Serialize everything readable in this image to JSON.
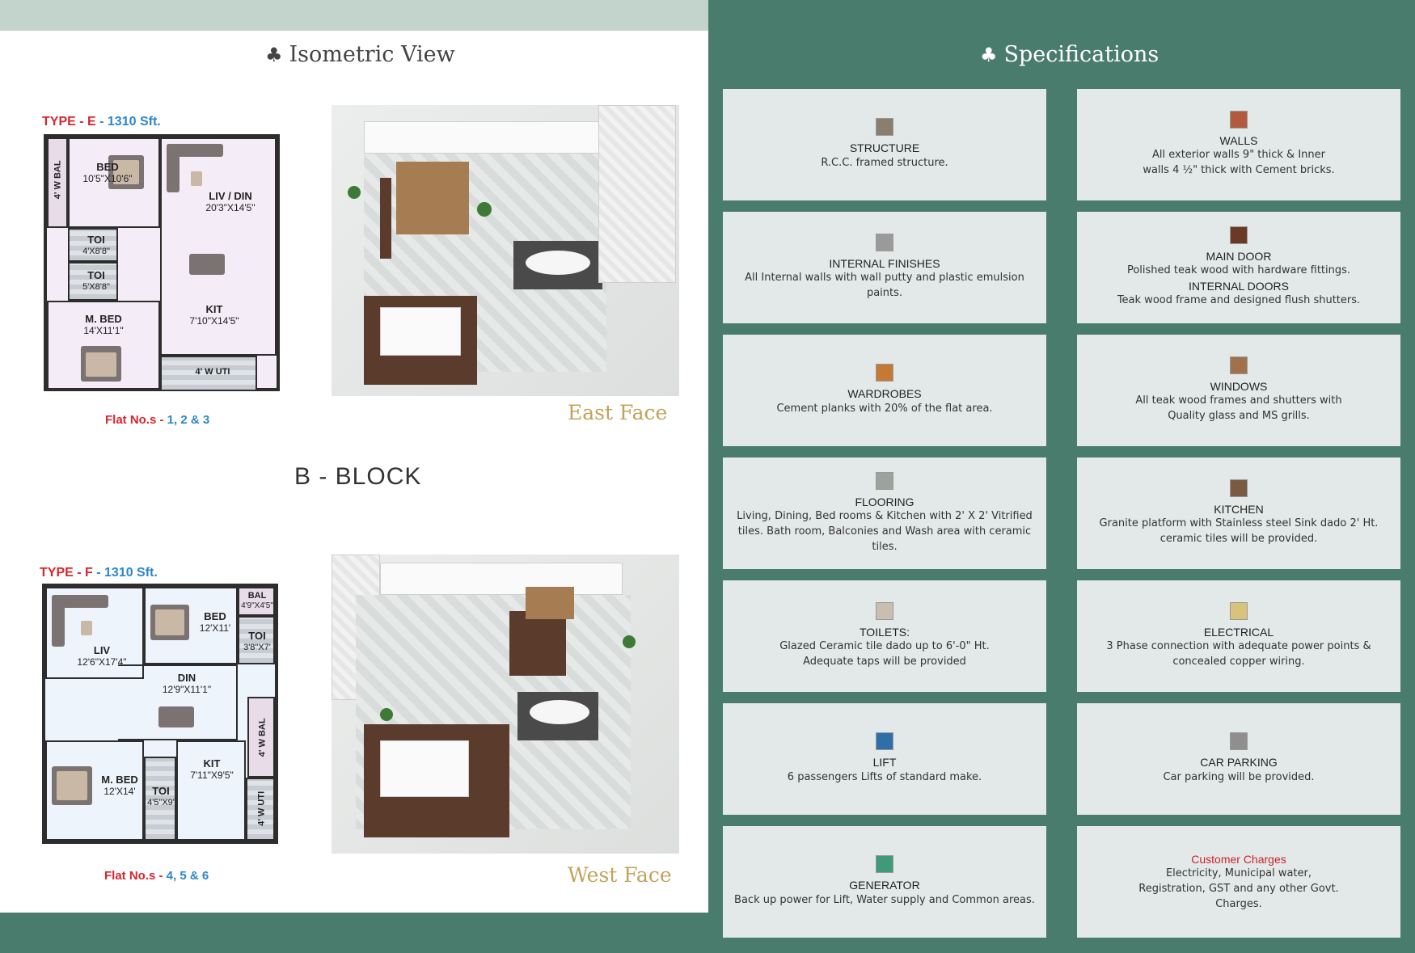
{
  "left": {
    "isometric_title": "Isometric View",
    "block_title": "B - BLOCK",
    "type_e": {
      "prefix": "TYPE - ",
      "letter": "E",
      "area": " - 1310 Sft."
    },
    "type_f": {
      "prefix": "TYPE - ",
      "letter": "F",
      "area": " - 1310 Sft."
    },
    "flat_e": {
      "label": "Flat No.s  - ",
      "numbers": " 1, 2 & 3"
    },
    "flat_f": {
      "label": "Flat No.s  - ",
      "numbers": " 4, 5 & 6"
    },
    "east_face": "East Face",
    "west_face": "West Face",
    "plan_e_rooms": {
      "bal": "4' W BAL",
      "bed_name": "BED",
      "bed_dim": "10'5\"X10'6\"",
      "liv_name": "LIV / DIN",
      "liv_dim": "20'3\"X14'5\"",
      "toi1_name": "TOI",
      "toi1_dim": "4'X8'8\"",
      "toi2_name": "TOI",
      "toi2_dim": "5'X8'8\"",
      "mbed_name": "M. BED",
      "mbed_dim": "14'X11'1\"",
      "kit_name": "KIT",
      "kit_dim": "7'10\"X14'5\"",
      "uti": "4' W UTI"
    },
    "plan_f_rooms": {
      "liv_name": "LIV",
      "liv_dim": "12'6\"X17'4\"",
      "bed_name": "BED",
      "bed_dim": "12'X11'",
      "bal_name": "BAL",
      "bal_dim": "4'9\"X4'5\"",
      "toi1_name": "TOI",
      "toi1_dim": "3'8\"X7'",
      "din_name": "DIN",
      "din_dim": "12'9\"X11'1\"",
      "bal2": "4' W BAL",
      "mbed_name": "M. BED",
      "mbed_dim": "12'X14'",
      "toi2_name": "TOI",
      "toi2_dim": "4'5\"X9'",
      "kit_name": "KIT",
      "kit_dim": "7'11\"X9'5\"",
      "uti": "4' W UTI"
    }
  },
  "right": {
    "specifications_title": "Specifications",
    "specs": [
      {
        "title": "STRUCTURE",
        "desc": "R.C.C. framed structure."
      },
      {
        "title": "WALLS",
        "desc": "All exterior walls 9\" thick & Inner walls 4 ½\" thick with Cement bricks."
      },
      {
        "title": "INTERNAL FINISHES",
        "desc": "All Internal walls with wall putty and plastic emulsion paints."
      },
      {
        "title": "MAIN DOOR",
        "desc": "Polished teak wood with hardware fittings.",
        "title2": "INTERNAL DOORS",
        "desc2": "Teak wood frame and designed flush shutters."
      },
      {
        "title": "WARDROBES",
        "desc": "Cement planks with 20% of the flat area."
      },
      {
        "title": "WINDOWS",
        "desc": "All teak wood frames and shutters with Quality glass and MS grills."
      },
      {
        "title": "FLOORING",
        "desc": "Living, Dining, Bed rooms & Kitchen with 2' X 2' Vitrified tiles. Bath room, Balconies and Wash area with ceramic tiles."
      },
      {
        "title": "KITCHEN",
        "desc": "Granite platform with Stainless steel Sink dado 2' Ht. ceramic tiles will be provided."
      },
      {
        "title": "TOILETS:",
        "desc": "Glazed Ceramic tile dado up to 6'-0\" Ht. Adequate taps will be provided"
      },
      {
        "title": "ELECTRICAL",
        "desc": "3 Phase connection with adequate power points & concealed copper wiring."
      },
      {
        "title": "LIFT",
        "desc": "6 passengers Lifts of standard make."
      },
      {
        "title": "CAR PARKING",
        "desc": "Car parking will be provided."
      },
      {
        "title": "GENERATOR",
        "desc": "Back up power for Lift, Water supply and Common areas."
      },
      {
        "title": "Customer Charges",
        "desc": "Electricity, Municipal water, Registration, GST and any other Govt. Charges."
      }
    ],
    "icon_colors": [
      "#8a7f6e",
      "#b45a3c",
      "#9a9a9a",
      "#6b3a24",
      "#c47a34",
      "#a0714a",
      "#9aa39c",
      "#7a5a40",
      "#c9bfb0",
      "#d9c27a",
      "#2f6ea8",
      "#8f8f8f",
      "#3f9a7a",
      ""
    ]
  },
  "colors": {
    "green": "#4a7c6d",
    "card": "#e3e9e8",
    "gold": "#c3a35a",
    "red": "#d8262f",
    "blue": "#2c86c8"
  }
}
